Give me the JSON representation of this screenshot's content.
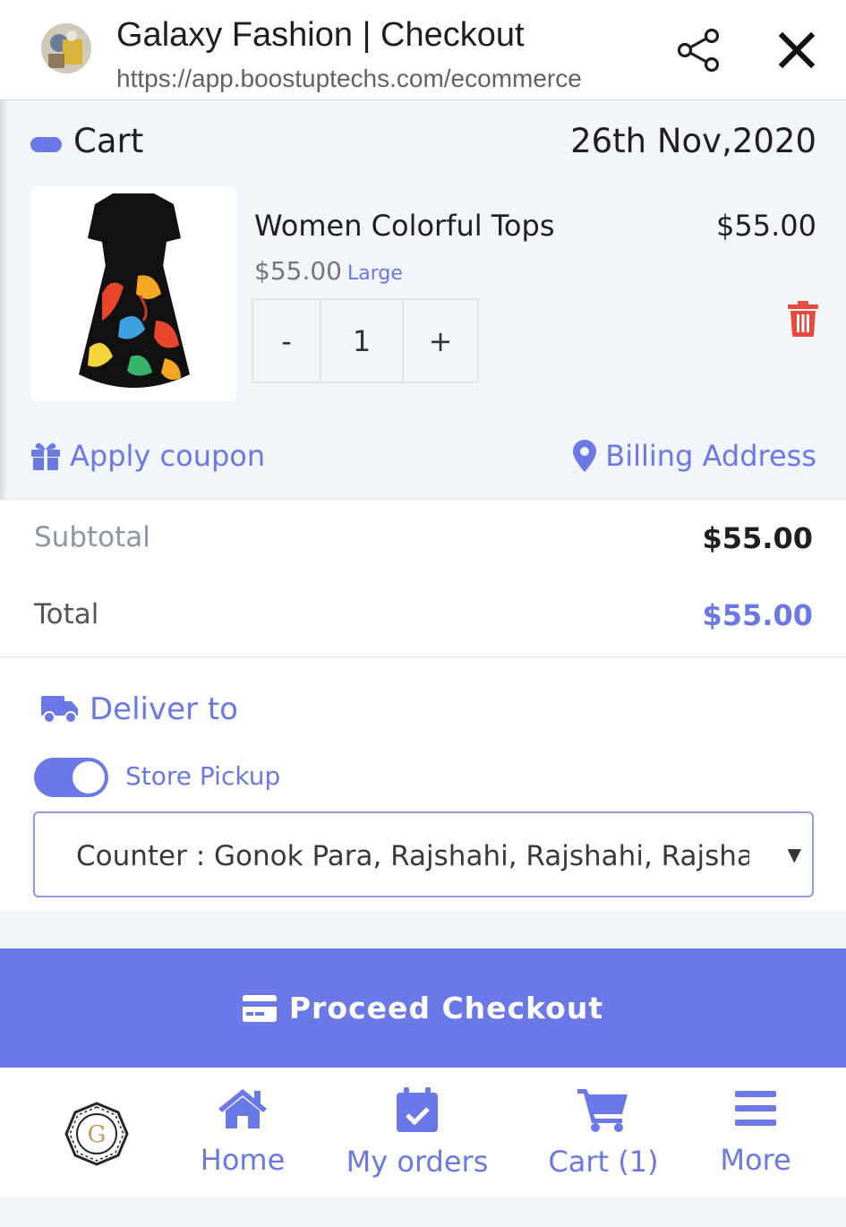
{
  "browser": {
    "title": "Galaxy Fashion | Checkout",
    "url": "https://app.boostuptechs.com/ecommerce"
  },
  "cart": {
    "heading": "Cart",
    "date": "26th Nov,2020",
    "item": {
      "name": "Women Colorful Tops",
      "total": "$55.00",
      "price": "$55.00",
      "size": "Large",
      "quantity": "1",
      "minus": "-",
      "plus": "+"
    },
    "apply_coupon": "Apply coupon",
    "billing_address": "Billing Address"
  },
  "summary": {
    "subtotal_label": "Subtotal",
    "subtotal_value": "$55.00",
    "total_label": "Total",
    "total_value": "$55.00"
  },
  "delivery": {
    "heading": "Deliver to",
    "store_pickup_label": "Store Pickup",
    "store_pickup_on": true,
    "counter_selected": "Counter : Gonok Para, Rajshahi, Rajshahi, Rajshahi"
  },
  "checkout_label": "Proceed Checkout",
  "nav": {
    "logo_letter": "G",
    "home": "Home",
    "my_orders": "My orders",
    "cart": "Cart (1)",
    "more": "More"
  },
  "colors": {
    "accent": "#6a78e8",
    "delete": "#e64a3b"
  }
}
